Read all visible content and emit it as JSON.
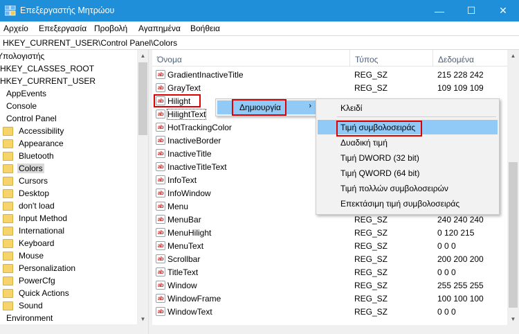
{
  "window": {
    "title": "Επεξεργαστής Μητρώου",
    "min_glyph": "—",
    "max_glyph": "☐",
    "close_glyph": "✕"
  },
  "menubar": [
    "Αρχείο",
    "Επεξεργασία",
    "Προβολή",
    "Αγαπημένα",
    "Βοήθεια"
  ],
  "address": "HKEY_CURRENT_USER\\Control Panel\\Colors",
  "tree": [
    {
      "label": "Υπολογιστής",
      "folder": false
    },
    {
      "label": "HKEY_CLASSES_ROOT",
      "folder": false
    },
    {
      "label": "HKEY_CURRENT_USER",
      "folder": false
    },
    {
      "label": "AppEvents",
      "folder": false
    },
    {
      "label": "Console",
      "folder": false
    },
    {
      "label": "Control Panel",
      "folder": false
    },
    {
      "label": "Accessibility",
      "folder": true
    },
    {
      "label": "Appearance",
      "folder": true
    },
    {
      "label": "Bluetooth",
      "folder": true
    },
    {
      "label": "Colors",
      "folder": true,
      "selected": true
    },
    {
      "label": "Cursors",
      "folder": true
    },
    {
      "label": "Desktop",
      "folder": true
    },
    {
      "label": "don't load",
      "folder": true
    },
    {
      "label": "Input Method",
      "folder": true
    },
    {
      "label": "International",
      "folder": true
    },
    {
      "label": "Keyboard",
      "folder": true
    },
    {
      "label": "Mouse",
      "folder": true
    },
    {
      "label": "Personalization",
      "folder": true
    },
    {
      "label": "PowerCfg",
      "folder": true
    },
    {
      "label": "Quick Actions",
      "folder": true
    },
    {
      "label": "Sound",
      "folder": true
    },
    {
      "label": "Environment",
      "folder": false
    }
  ],
  "columns": {
    "name": "Όνομα",
    "type": "Τύπος",
    "data": "Δεδομένα"
  },
  "values": [
    {
      "name": "GradientInactiveTitle",
      "type": "REG_SZ",
      "data": "215 228 242"
    },
    {
      "name": "GrayText",
      "type": "REG_SZ",
      "data": "109 109 109"
    },
    {
      "name": "Hilight",
      "type": "",
      "data": ""
    },
    {
      "name": "HilightText",
      "type": "",
      "data": ""
    },
    {
      "name": "HotTrackingColor",
      "type": "",
      "data": ""
    },
    {
      "name": "InactiveBorder",
      "type": "",
      "data": ""
    },
    {
      "name": "InactiveTitle",
      "type": "",
      "data": ""
    },
    {
      "name": "InactiveTitleText",
      "type": "",
      "data": ""
    },
    {
      "name": "InfoText",
      "type": "",
      "data": ""
    },
    {
      "name": "InfoWindow",
      "type": "",
      "data": ""
    },
    {
      "name": "Menu",
      "type": "",
      "data": ""
    },
    {
      "name": "MenuBar",
      "type": "REG_SZ",
      "data": "240 240 240"
    },
    {
      "name": "MenuHilight",
      "type": "REG_SZ",
      "data": "0 120 215"
    },
    {
      "name": "MenuText",
      "type": "REG_SZ",
      "data": "0 0 0"
    },
    {
      "name": "Scrollbar",
      "type": "REG_SZ",
      "data": "200 200 200"
    },
    {
      "name": "TitleText",
      "type": "REG_SZ",
      "data": "0 0 0"
    },
    {
      "name": "Window",
      "type": "REG_SZ",
      "data": "255 255 255"
    },
    {
      "name": "WindowFrame",
      "type": "REG_SZ",
      "data": "100 100 100"
    },
    {
      "name": "WindowText",
      "type": "REG_SZ",
      "data": "0 0 0"
    }
  ],
  "context_menu": {
    "new_label": "Δημιουργία",
    "submenu_arrow": "›"
  },
  "submenu": [
    "Κλειδί",
    "Τιμή συμβολοσειράς",
    "Δυαδική τιμή",
    "Τιμή DWORD (32 bit)",
    "Τιμή QWORD (64 bit)",
    "Τιμή πολλών συμβολοσειρών",
    "Επεκτάσιμη τιμή συμβολοσειράς"
  ],
  "ab_icon_text": "ab",
  "colors": {
    "titlebar": "#1e8fd8",
    "menu_highlight": "#91c9f7",
    "callout_red": "#e00000",
    "ab_icon_red": "#d11f1f"
  }
}
